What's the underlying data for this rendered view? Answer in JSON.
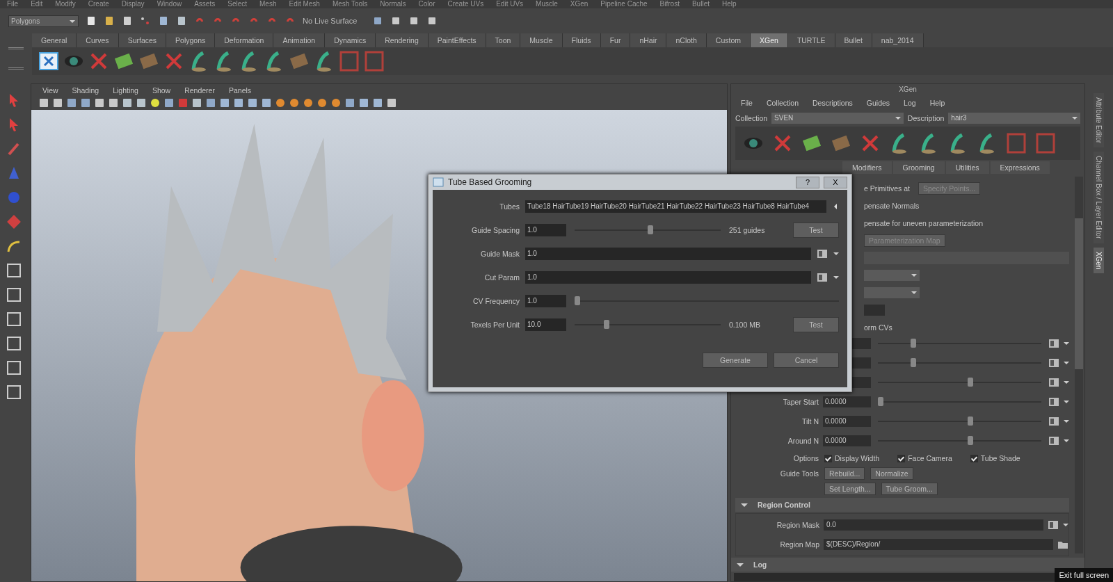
{
  "menubar": [
    "File",
    "Edit",
    "Modify",
    "Create",
    "Display",
    "Window",
    "Assets",
    "Select",
    "Mesh",
    "Edit Mesh",
    "Mesh Tools",
    "Normals",
    "Color",
    "Create UVs",
    "Edit UVs",
    "Muscle",
    "XGen",
    "Pipeline Cache",
    "Bifrost",
    "Bullet",
    "Help"
  ],
  "status_line": {
    "mode": "Polygons",
    "live_surface": "No Live Surface"
  },
  "shelf_tabs": [
    {
      "label": "General",
      "selected": false
    },
    {
      "label": "Curves",
      "selected": false
    },
    {
      "label": "Surfaces",
      "selected": false
    },
    {
      "label": "Polygons",
      "selected": false
    },
    {
      "label": "Deformation",
      "selected": false
    },
    {
      "label": "Animation",
      "selected": false
    },
    {
      "label": "Dynamics",
      "selected": false
    },
    {
      "label": "Rendering",
      "selected": false
    },
    {
      "label": "PaintEffects",
      "selected": false
    },
    {
      "label": "Toon",
      "selected": false
    },
    {
      "label": "Muscle",
      "selected": false
    },
    {
      "label": "Fluids",
      "selected": false
    },
    {
      "label": "Fur",
      "selected": false
    },
    {
      "label": "nHair",
      "selected": false
    },
    {
      "label": "nCloth",
      "selected": false
    },
    {
      "label": "Custom",
      "selected": false
    },
    {
      "label": "XGen",
      "selected": true
    },
    {
      "label": "TURTLE",
      "selected": false
    },
    {
      "label": "Bullet",
      "selected": false
    },
    {
      "label": "nab_2014",
      "selected": false
    }
  ],
  "viewport": {
    "menus": [
      "View",
      "Shading",
      "Lighting",
      "Show",
      "Renderer",
      "Panels"
    ]
  },
  "xgen": {
    "title": "XGen",
    "menus": [
      "File",
      "Collection",
      "Descriptions",
      "Guides",
      "Log",
      "Help"
    ],
    "collection_label": "Collection",
    "collection": "SVEN",
    "description_label": "Description",
    "description": "hair3",
    "tabs": [
      {
        "label": "Modifiers",
        "selected": false
      },
      {
        "label": "Grooming",
        "selected": false
      },
      {
        "label": "Utilities",
        "selected": false
      },
      {
        "label": "Expressions",
        "selected": false
      }
    ],
    "upper": [
      {
        "kind": "text_button",
        "text": "e Primitives at",
        "button": "Specify Points..."
      },
      {
        "kind": "text",
        "text": "pensate Normals"
      },
      {
        "kind": "text",
        "text": "pensate for uneven parameterization"
      },
      {
        "kind": "button",
        "button": "Parameterization Map"
      },
      {
        "kind": "bar"
      },
      {
        "kind": "dropdown"
      },
      {
        "kind": "dropdown"
      },
      {
        "kind": "field"
      },
      {
        "kind": "text",
        "text": "orm CVs"
      }
    ],
    "sliders": [
      {
        "level": 0.2
      },
      {
        "level": 0.2
      },
      {
        "level": 0.55
      },
      {
        "label": "Taper Start",
        "value": "0.0000",
        "level": 0.0
      },
      {
        "label": "Tilt N",
        "value": "0.0000",
        "level": 0.55
      },
      {
        "label": "Around N",
        "value": "0.0000",
        "level": 0.55
      }
    ],
    "options_label": "Options",
    "options": [
      {
        "label": "Display Width",
        "checked": true
      },
      {
        "label": "Face Camera",
        "checked": true
      },
      {
        "label": "Tube Shade",
        "checked": true
      }
    ],
    "guide_tools_label": "Guide Tools",
    "guide_tools": [
      [
        "Rebuild...",
        "Normalize"
      ],
      [
        "Set Length...",
        "Tube Groom..."
      ]
    ],
    "region_control": {
      "title": "Region Control",
      "expanded": true,
      "mask_label": "Region Mask",
      "mask": "0.0",
      "map_label": "Region Map",
      "map": "$(DESC)/Region/"
    },
    "log": {
      "title": "Log",
      "expanded": true
    }
  },
  "side_tabs": [
    {
      "label": "Attribute Editor",
      "selected": false
    },
    {
      "label": "Channel Box / Layer Editor",
      "selected": false
    },
    {
      "label": "XGen",
      "selected": true
    }
  ],
  "dialog": {
    "title": "Tube Based Grooming",
    "help": "?",
    "close": "X",
    "rows": [
      {
        "kind": "text",
        "label": "Tubes",
        "value": "Tube18 HairTube19 HairTube20 HairTube21 HairTube22 HairTube23 HairTube8 HairTube4"
      },
      {
        "kind": "slider",
        "label": "Guide Spacing",
        "value": "1.0",
        "level": 0.5,
        "reading": "251 guides",
        "button": "Test"
      },
      {
        "kind": "map",
        "label": "Guide Mask",
        "value": "1.0"
      },
      {
        "kind": "map",
        "label": "Cut Param",
        "value": "1.0"
      },
      {
        "kind": "slider",
        "label": "CV Frequency",
        "value": "1.0",
        "level": 0.0
      },
      {
        "kind": "slider",
        "label": "Texels Per Unit",
        "value": "10.0",
        "level": 0.2,
        "reading": "0.100 MB",
        "button": "Test"
      }
    ],
    "buttons": [
      "Generate",
      "Cancel"
    ]
  },
  "overlay_hint": "Exit full screen"
}
